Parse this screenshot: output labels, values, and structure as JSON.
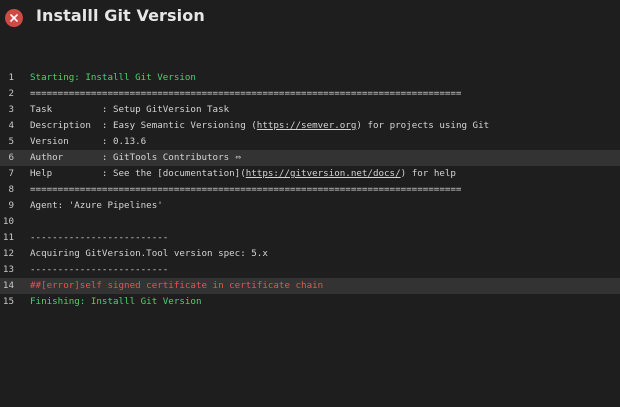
{
  "header": {
    "status_icon": "error-close-icon",
    "title": "Installl Git Version"
  },
  "colors": {
    "background": "#1e1e1e",
    "error_icon": "#cd4a45",
    "success_text": "#4ed06e",
    "error_text": "#e9544b",
    "highlight_row": "#333333"
  },
  "log": {
    "lines": [
      {
        "n": "1",
        "text": "Starting: Installl Git Version"
      },
      {
        "n": "2",
        "text": "=============================================================================="
      },
      {
        "n": "3",
        "text": "Task         : Setup GitVersion Task"
      },
      {
        "n": "4",
        "pre": "Description  : Easy Semantic Versioning (",
        "link": "https://semver.org",
        "post": ") for projects using Git"
      },
      {
        "n": "5",
        "text": "Version      : 0.13.6"
      },
      {
        "n": "6",
        "text": "Author       : GitTools Contributors",
        "icon": "link-icon"
      },
      {
        "n": "7",
        "pre": "Help         : See the [documentation](",
        "link": "https://gitversion.net/docs/",
        "post": ") for help"
      },
      {
        "n": "8",
        "text": "=============================================================================="
      },
      {
        "n": "9",
        "text": "Agent: 'Azure Pipelines'"
      },
      {
        "n": "10",
        "text": ""
      },
      {
        "n": "11",
        "text": "-------------------------"
      },
      {
        "n": "12",
        "text": "Acquiring GitVersion.Tool version spec: 5.x"
      },
      {
        "n": "13",
        "text": "-------------------------"
      },
      {
        "n": "14",
        "text": "##[error]self signed certificate in certificate chain"
      },
      {
        "n": "15",
        "text": "Finishing: Installl Git Version"
      }
    ]
  }
}
